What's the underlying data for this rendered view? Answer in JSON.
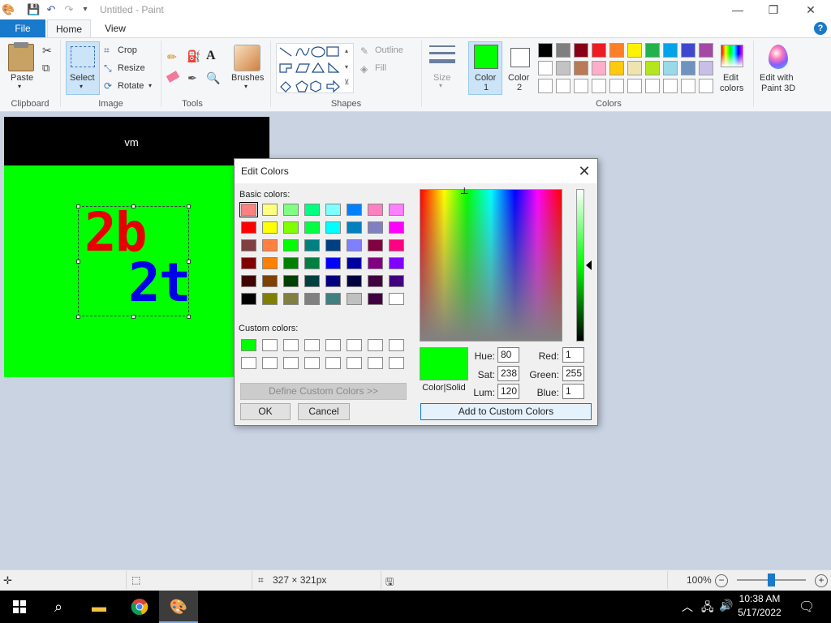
{
  "app": {
    "title": "Untitled - Paint",
    "window_controls": {
      "minimize": "—",
      "maximize": "❐",
      "close": "✕"
    }
  },
  "tabs": {
    "file": "File",
    "home": "Home",
    "view": "View",
    "help": "?"
  },
  "ribbon": {
    "clipboard": {
      "paste": "Paste",
      "group": "Clipboard"
    },
    "image": {
      "select": "Select",
      "crop": "Crop",
      "resize": "Resize",
      "rotate": "Rotate",
      "group": "Image"
    },
    "tools": {
      "group": "Tools"
    },
    "brushes": "Brushes",
    "shapes": {
      "outline": "Outline",
      "fill": "Fill",
      "group": "Shapes"
    },
    "size": "Size",
    "color1": {
      "label": "Color",
      "num": "1",
      "hex": "#00ff00"
    },
    "color2": {
      "label": "Color",
      "num": "2",
      "hex": "#ffffff"
    },
    "colors_group": "Colors",
    "edit_colors": {
      "line1": "Edit",
      "line2": "colors"
    },
    "paint3d": {
      "line1": "Edit with",
      "line2": "Paint 3D"
    },
    "palette_row1": [
      "#000000",
      "#7f7f7f",
      "#880015",
      "#ed1c24",
      "#ff7f27",
      "#fff200",
      "#22b14c",
      "#00a2e8",
      "#3f48cc",
      "#a349a4"
    ],
    "palette_row2": [
      "#ffffff",
      "#c3c3c3",
      "#b97a57",
      "#ffaec9",
      "#ffc90e",
      "#efe4b0",
      "#b5e61d",
      "#99d9ea",
      "#7092be",
      "#c8bfe7"
    ],
    "palette_row3": [
      "#ffffff",
      "#ffffff",
      "#ffffff",
      "#ffffff",
      "#ffffff",
      "#ffffff",
      "#ffffff",
      "#ffffff",
      "#ffffff",
      "#ffffff"
    ]
  },
  "canvas": {
    "header_text": "vm",
    "text_red": "2b",
    "text_blue": "2t",
    "bg_hex": "#00ff00"
  },
  "dialog": {
    "title": "Edit Colors",
    "basic_colors_label": "Basic colors:",
    "custom_colors_label": "Custom colors:",
    "basic_colors": [
      [
        "#ff8080",
        "#ffff80",
        "#80ff80",
        "#00ff80",
        "#80ffff",
        "#0080ff",
        "#ff80c0",
        "#ff80ff"
      ],
      [
        "#ff0000",
        "#ffff00",
        "#80ff00",
        "#00ff40",
        "#00ffff",
        "#0080c0",
        "#8080c0",
        "#ff00ff"
      ],
      [
        "#804040",
        "#ff8040",
        "#00ff00",
        "#008080",
        "#004080",
        "#8080ff",
        "#800040",
        "#ff0080"
      ],
      [
        "#800000",
        "#ff8000",
        "#008000",
        "#008040",
        "#0000ff",
        "#0000a0",
        "#800080",
        "#8000ff"
      ],
      [
        "#400000",
        "#804000",
        "#004000",
        "#004040",
        "#000080",
        "#000040",
        "#400040",
        "#400080"
      ],
      [
        "#000000",
        "#808000",
        "#808040",
        "#808080",
        "#408080",
        "#c0c0c0",
        "#400040",
        "#ffffff"
      ]
    ],
    "custom_colors": [
      [
        "#00ff00",
        "#ffffff",
        "#ffffff",
        "#ffffff",
        "#ffffff",
        "#ffffff",
        "#ffffff",
        "#ffffff"
      ],
      [
        "#ffffff",
        "#ffffff",
        "#ffffff",
        "#ffffff",
        "#ffffff",
        "#ffffff",
        "#ffffff",
        "#ffffff"
      ]
    ],
    "define_custom": "Define Custom Colors >>",
    "ok": "OK",
    "cancel": "Cancel",
    "color_solid": "Color|Solid",
    "hue_label": "Hue:",
    "hue": "80",
    "sat_label": "Sat:",
    "sat": "238",
    "lum_label": "Lum:",
    "lum": "120",
    "red_label": "Red:",
    "red": "1",
    "green_label": "Green:",
    "green": "255",
    "blue_label": "Blue:",
    "blue": "1",
    "add_custom": "Add to Custom Colors"
  },
  "status": {
    "size": "327 × 321px",
    "zoom": "100%",
    "zoom_level": 1.0
  },
  "taskbar": {
    "time": "10:38 AM",
    "date": "5/17/2022"
  }
}
